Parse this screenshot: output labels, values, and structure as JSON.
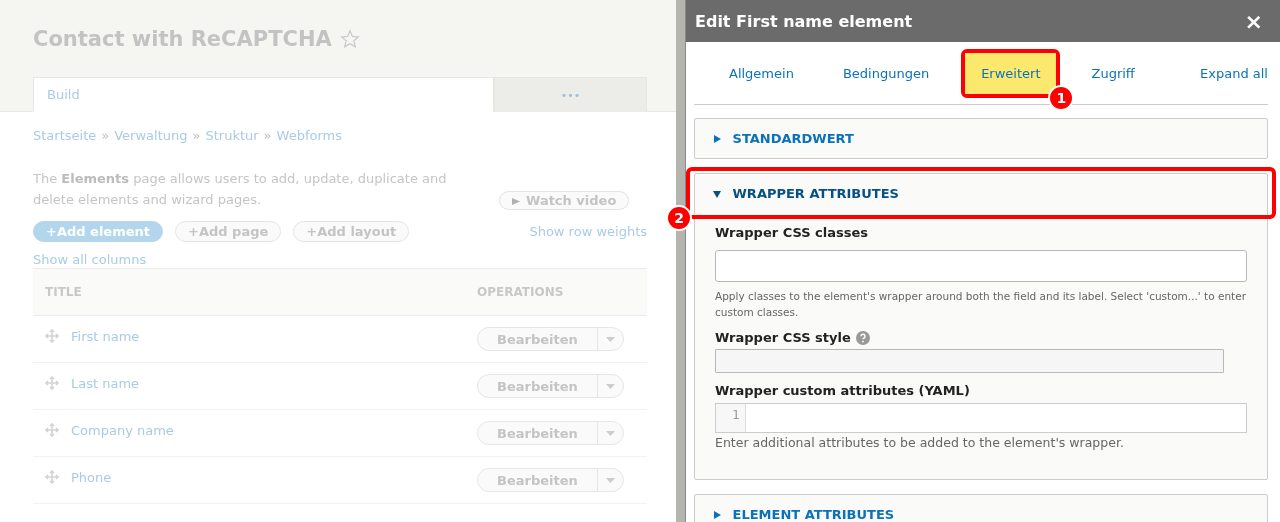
{
  "page": {
    "title": "Contact with ReCAPTCHA",
    "tabs": [
      {
        "label": "Build",
        "selected": true
      },
      {
        "label": "•••",
        "selected": false
      }
    ],
    "breadcrumb": [
      {
        "label": "Startseite"
      },
      {
        "separator": "»",
        "label": "Verwaltung"
      },
      {
        "separator": "»",
        "label": "Struktur"
      },
      {
        "separator": "»",
        "label": "Webforms"
      }
    ],
    "description": "The **Elements** page allows users to add, update, duplicate and delete elements and wizard pages.",
    "watch_video": "Watch video",
    "actions": [
      {
        "label": "+Add element",
        "kind": "primary"
      },
      {
        "label": "+Add page",
        "kind": "secondary"
      },
      {
        "label": "+Add layout",
        "kind": "secondary"
      }
    ],
    "show_row_weights": "Show row weights",
    "show_all_columns": "Show all columns",
    "table": {
      "columns": [
        "TITLE",
        "OPERATIONS"
      ],
      "rows": [
        {
          "title": "First name",
          "operation": "Bearbeiten"
        },
        {
          "title": "Last name",
          "operation": "Bearbeiten"
        },
        {
          "title": "Company name",
          "operation": "Bearbeiten"
        },
        {
          "title": "Phone",
          "operation": "Bearbeiten"
        }
      ]
    }
  },
  "dialog": {
    "title": "Edit First name element",
    "close": "×",
    "tabs": [
      {
        "label": "Allgemein",
        "selected": false
      },
      {
        "label": "Bedingungen",
        "selected": false
      },
      {
        "label": "Erweitert",
        "selected": true,
        "callout": "1"
      },
      {
        "label": "Zugriff",
        "selected": false
      }
    ],
    "expand_all": "Expand all",
    "sections": [
      {
        "title": "STANDARDWERT",
        "expanded": false
      },
      {
        "title": "WRAPPER ATTRIBUTES",
        "expanded": true,
        "callout": "2",
        "fields": [
          {
            "kind": "text",
            "label": "Wrapper CSS classes",
            "help": "Apply classes to the element's wrapper around both the field and its label. Select 'custom...' to enter custom classes."
          },
          {
            "kind": "short",
            "label": "Wrapper CSS style",
            "has_tooltip": true
          },
          {
            "kind": "code",
            "label": "Wrapper custom attributes (YAML)",
            "line": "1",
            "help": "Enter additional attributes to be added to the element's wrapper."
          }
        ]
      },
      {
        "title": "ELEMENT ATTRIBUTES",
        "expanded": false
      }
    ]
  }
}
